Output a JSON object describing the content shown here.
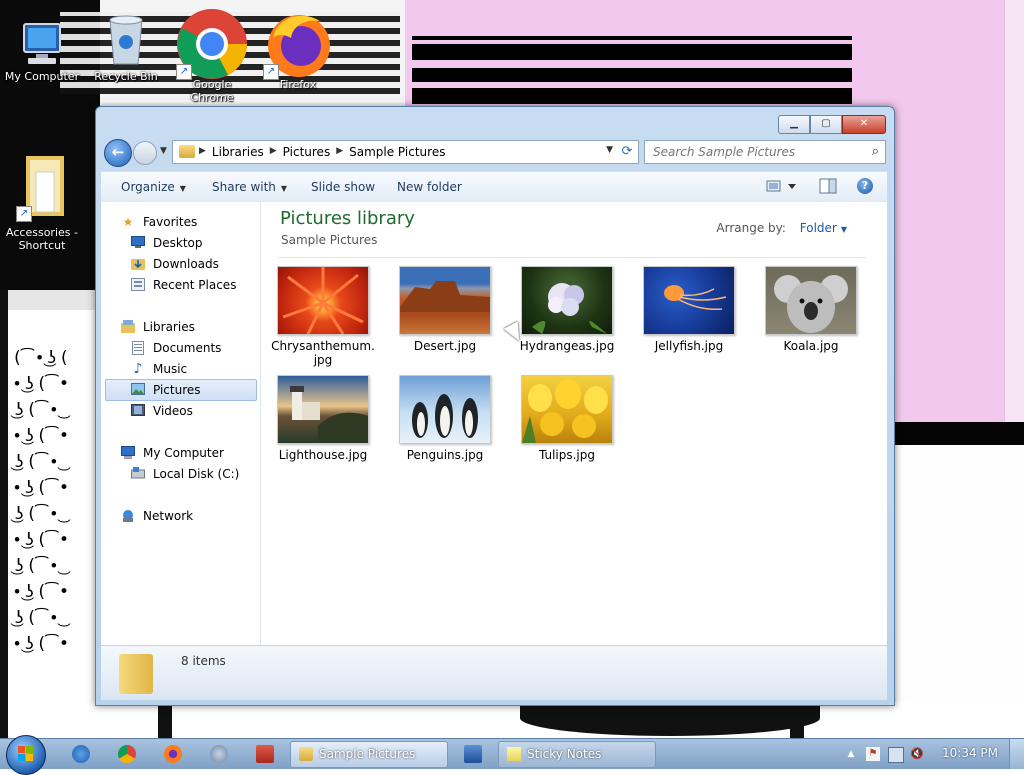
{
  "desktop": {
    "icons": [
      {
        "label": "My Computer",
        "icon": "computer-icon"
      },
      {
        "label": "Recycle Bin",
        "icon": "recycle-bin-icon"
      },
      {
        "label": "Google Chrome",
        "icon": "chrome-icon"
      },
      {
        "label": "Firefox",
        "icon": "firefox-icon"
      },
      {
        "label": "Accessories - Shortcut",
        "icon": "folder-shortcut-icon"
      }
    ]
  },
  "window": {
    "title": "Sample Pictures",
    "breadcrumbs": [
      "Libraries",
      "Pictures",
      "Sample Pictures"
    ],
    "search_placeholder": "Search Sample Pictures",
    "toolbar": {
      "organize": "Organize",
      "share_with": "Share with",
      "slide_show": "Slide show",
      "new_folder": "New folder"
    },
    "nav": {
      "favorites": "Favorites",
      "desktop": "Desktop",
      "downloads": "Downloads",
      "recent_places": "Recent Places",
      "libraries": "Libraries",
      "documents": "Documents",
      "music": "Music",
      "pictures": "Pictures",
      "videos": "Videos",
      "my_computer": "My Computer",
      "local_disk": "Local Disk (C:)",
      "network": "Network"
    },
    "content": {
      "title": "Pictures library",
      "subtitle": "Sample Pictures",
      "arrange_label": "Arrange by:",
      "arrange_value": "Folder",
      "files": [
        {
          "name": "Chrysanthemum.jpg",
          "name_line1": "Chrysanthemum.",
          "name_line2": "jpg"
        },
        {
          "name": "Desert.jpg"
        },
        {
          "name": "Hydrangeas.jpg"
        },
        {
          "name": "Jellyfish.jpg"
        },
        {
          "name": "Koala.jpg"
        },
        {
          "name": "Lighthouse.jpg"
        },
        {
          "name": "Penguins.jpg"
        },
        {
          "name": "Tulips.jpg"
        }
      ]
    },
    "details": {
      "count": "8 items"
    }
  },
  "taskbar": {
    "tasks": [
      {
        "label": "Sample Pictures"
      },
      {
        "label": "Sticky Notes"
      }
    ],
    "clock": "10:34 PM"
  },
  "colors": {
    "accent": "#1e5aa8",
    "library_title": "#1e6a2e",
    "close_button": "#c7402a"
  }
}
